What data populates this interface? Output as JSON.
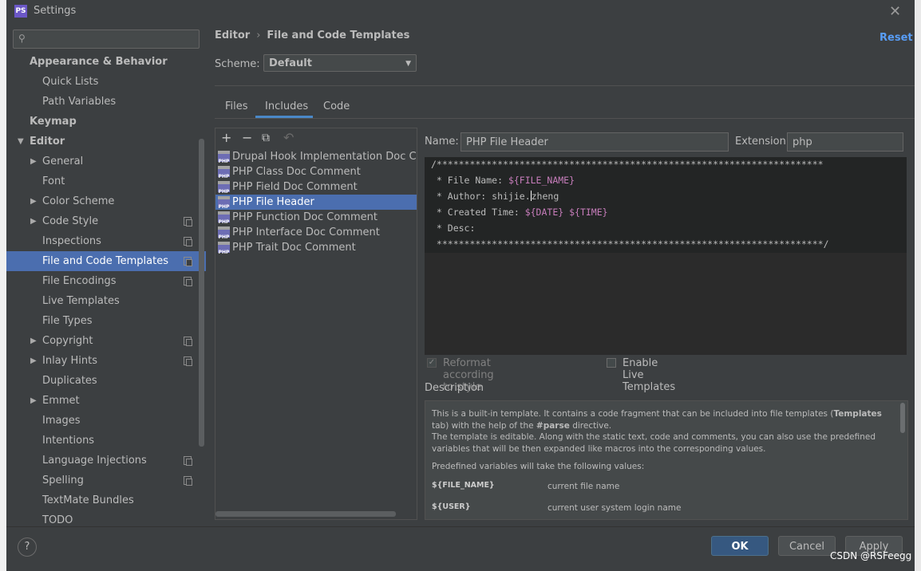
{
  "window": {
    "title": "Settings",
    "app_icon": "PS",
    "close_glyph": "✕"
  },
  "search": {
    "placeholder": ""
  },
  "sidebar": {
    "items": [
      {
        "label": "Appearance & Behavior",
        "level": 0,
        "bold": true
      },
      {
        "label": "Quick Lists",
        "level": 1
      },
      {
        "label": "Path Variables",
        "level": 1
      },
      {
        "label": "Keymap",
        "level": 0,
        "bold": true
      },
      {
        "label": "Editor",
        "level": 0,
        "bold": true,
        "expanded": true
      },
      {
        "label": "General",
        "level": 1,
        "collapsed": true
      },
      {
        "label": "Font",
        "level": 1
      },
      {
        "label": "Color Scheme",
        "level": 1,
        "collapsed": true
      },
      {
        "label": "Code Style",
        "level": 1,
        "collapsed": true,
        "copy": true
      },
      {
        "label": "Inspections",
        "level": 1,
        "copy": true
      },
      {
        "label": "File and Code Templates",
        "level": 1,
        "copy": true,
        "selected": true
      },
      {
        "label": "File Encodings",
        "level": 1,
        "copy": true
      },
      {
        "label": "Live Templates",
        "level": 1
      },
      {
        "label": "File Types",
        "level": 1
      },
      {
        "label": "Copyright",
        "level": 1,
        "collapsed": true,
        "copy": true
      },
      {
        "label": "Inlay Hints",
        "level": 1,
        "collapsed": true,
        "copy": true
      },
      {
        "label": "Duplicates",
        "level": 1
      },
      {
        "label": "Emmet",
        "level": 1,
        "collapsed": true
      },
      {
        "label": "Images",
        "level": 1
      },
      {
        "label": "Intentions",
        "level": 1
      },
      {
        "label": "Language Injections",
        "level": 1,
        "copy": true
      },
      {
        "label": "Spelling",
        "level": 1,
        "copy": true
      },
      {
        "label": "TextMate Bundles",
        "level": 1
      },
      {
        "label": "TODO",
        "level": 1
      }
    ]
  },
  "breadcrumb": {
    "parent": "Editor",
    "separator": "›",
    "current": "File and Code Templates"
  },
  "reset_label": "Reset",
  "scheme": {
    "label": "Scheme:",
    "value": "Default"
  },
  "tabs": [
    {
      "label": "Files"
    },
    {
      "label": "Includes",
      "active": true
    },
    {
      "label": "Code"
    }
  ],
  "toolbar": {
    "add": "+",
    "remove": "−",
    "copy": "⧉",
    "reset": "↶"
  },
  "template_list": [
    "Drupal Hook Implementation Doc Comment",
    "PHP Class Doc Comment",
    "PHP Field Doc Comment",
    "PHP File Header",
    "PHP Function Doc Comment",
    "PHP Interface Doc Comment",
    "PHP Trait Doc Comment"
  ],
  "selected_template_index": 3,
  "php_icon_text": "PHP",
  "name_field": {
    "label": "Name:",
    "value": "PHP File Header"
  },
  "extension_field": {
    "label": "Extension:",
    "value": "php"
  },
  "code": {
    "line1": "/**********************************************************************",
    "line2_prefix": " * File Name: ",
    "line2_var": "${FILE_NAME}",
    "line3_prefix": " * Author: shijie.",
    "line3_suffix": "zheng",
    "line4_prefix": " * Created Time: ",
    "line4_var1": "${DATE}",
    "line4_var2": "${TIME}",
    "line5": " * Desc:",
    "line6": " **********************************************************************/"
  },
  "options": {
    "reformat": {
      "label": "Reformat according to style",
      "checked": true,
      "disabled": true
    },
    "live_templates": {
      "label": "Enable Live Templates",
      "checked": false
    }
  },
  "description": {
    "label": "Description",
    "p1a": "This is a built-in template. It contains a code fragment that can be included into file templates (",
    "p1b": "Templates",
    "p1c": " tab) with the help of the ",
    "p1d": "#parse",
    "p1e": " directive.",
    "p2": "The template is editable. Along with the static text, code and comments, you can also use the predefined variables that will be then expanded like macros into the corresponding values.",
    "p3": "Predefined variables will take the following values:",
    "vars": [
      {
        "name": "${FILE_NAME}",
        "value": "current file name"
      },
      {
        "name": "${USER}",
        "value": "current user system login name"
      }
    ]
  },
  "footer": {
    "help": "?",
    "ok": "OK",
    "cancel": "Cancel",
    "apply": "Apply"
  },
  "watermark": "CSDN @RSFeegg"
}
